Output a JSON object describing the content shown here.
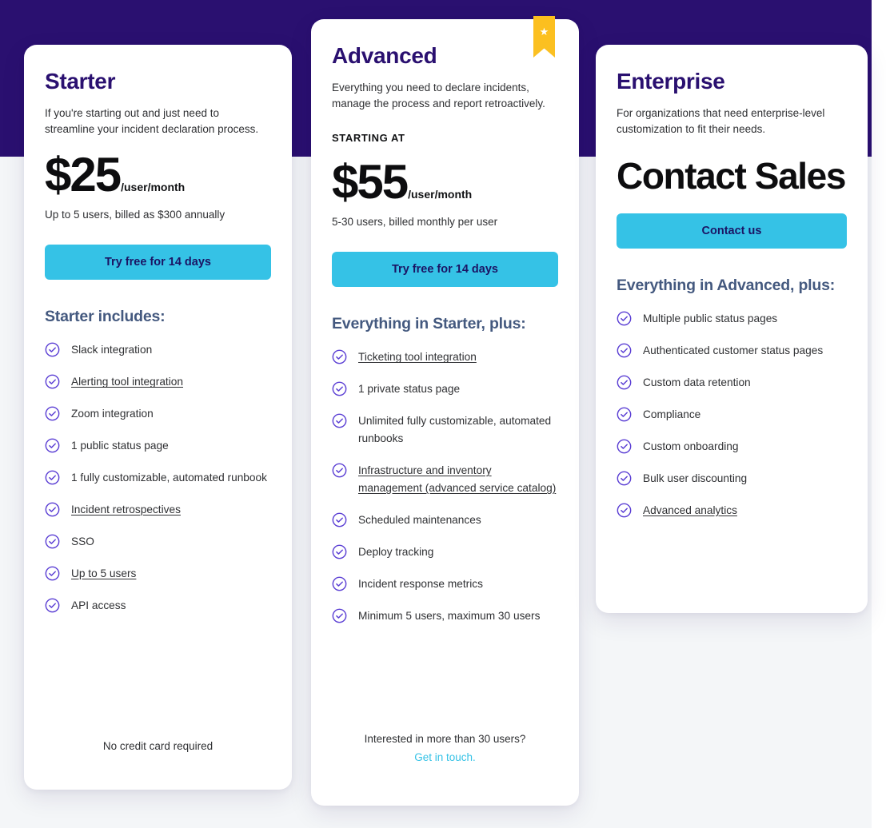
{
  "theme": {
    "background_purple": "#2a1070",
    "background_light": "#f4f6f8",
    "accent_cyan": "#35c2e6",
    "heading_indigo": "#2a1070",
    "includes_heading": "#44597f",
    "check_purple": "#5b3fd4",
    "ribbon_gold": "#fcbf1e"
  },
  "plans": [
    {
      "id": "starter",
      "name": "Starter",
      "description": "If you're starting out and just need to streamline your incident declaration process.",
      "starting_at_label": "",
      "price": "$25",
      "price_unit": "/user/month",
      "price_note": "Up to 5 users, billed as $300 annually",
      "cta_label": "Try free for 14 days",
      "includes_title": "Starter includes:",
      "features": [
        {
          "label": "Slack integration",
          "link": false
        },
        {
          "label": "Alerting tool integration",
          "link": true
        },
        {
          "label": "Zoom integration",
          "link": false
        },
        {
          "label": "1 public status page",
          "link": false
        },
        {
          "label": "1 fully customizable, automated runbook",
          "link": false
        },
        {
          "label": "Incident retrospectives",
          "link": true
        },
        {
          "label": "SSO",
          "link": false
        },
        {
          "label": "Up to 5 users",
          "link": true
        },
        {
          "label": "API access",
          "link": false
        }
      ],
      "footer_text": "No credit card required",
      "footer_link": ""
    },
    {
      "id": "advanced",
      "name": "Advanced",
      "description": "Everything you need to declare incidents, manage the process and report retroactively.",
      "starting_at_label": "STARTING AT",
      "price": "$55",
      "price_unit": "/user/month",
      "price_note": "5-30 users, billed monthly per user",
      "cta_label": "Try free for 14 days",
      "includes_title": "Everything in Starter, plus:",
      "badge": "star",
      "features": [
        {
          "label": "Ticketing tool integration",
          "link": true
        },
        {
          "label": "1 private status page",
          "link": false
        },
        {
          "label": "Unlimited fully customizable, automated runbooks",
          "link": false
        },
        {
          "label": "Infrastructure and inventory management (advanced service catalog)",
          "link": true
        },
        {
          "label": "Scheduled maintenances",
          "link": false
        },
        {
          "label": "Deploy tracking",
          "link": false
        },
        {
          "label": "Incident response metrics",
          "link": false
        },
        {
          "label": "Minimum 5 users, maximum 30 users",
          "link": false
        }
      ],
      "footer_text": "Interested in more than 30 users?",
      "footer_link": "Get in touch."
    },
    {
      "id": "enterprise",
      "name": "Enterprise",
      "description": "For organizations that need enterprise-level customization to fit their needs.",
      "starting_at_label": "",
      "price": "Contact Sales",
      "price_unit": "",
      "price_note": "",
      "cta_label": "Contact us",
      "includes_title": "Everything in Advanced, plus:",
      "features": [
        {
          "label": "Multiple public status pages",
          "link": false
        },
        {
          "label": "Authenticated customer status pages",
          "link": false
        },
        {
          "label": "Custom data retention",
          "link": false
        },
        {
          "label": "Compliance",
          "link": false
        },
        {
          "label": "Custom onboarding",
          "link": false
        },
        {
          "label": "Bulk user discounting",
          "link": false
        },
        {
          "label": "Advanced analytics",
          "link": true
        }
      ],
      "footer_text": "",
      "footer_link": ""
    }
  ]
}
